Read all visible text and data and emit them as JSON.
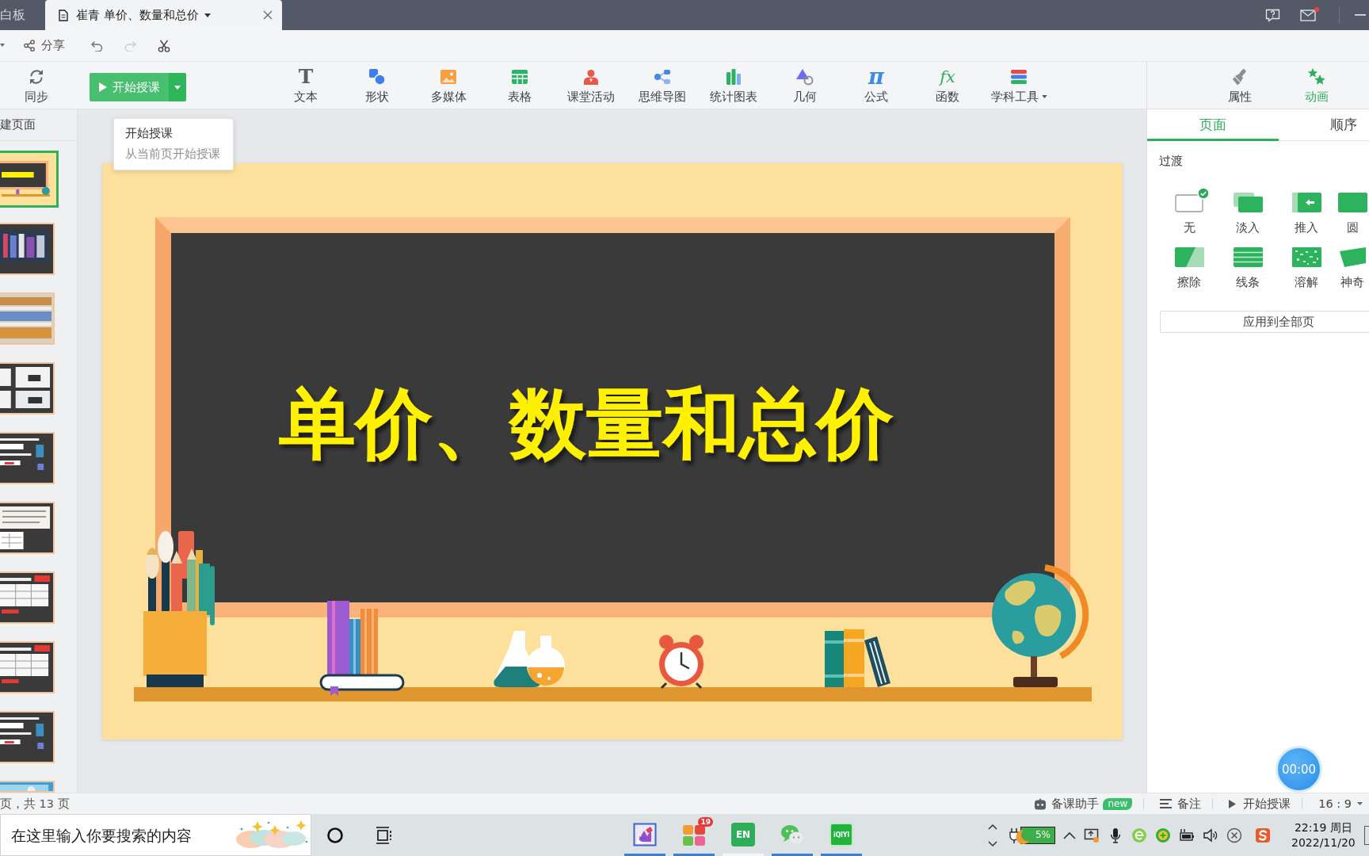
{
  "title_bar": {
    "tabs": [
      {
        "label": "白板",
        "selected": false
      },
      {
        "label": "崔青 单价、数量和总价",
        "selected": true
      }
    ],
    "mail_unread": true
  },
  "quick_bar": {
    "share": "分享",
    "undo_disabled": false,
    "redo_disabled": true
  },
  "ribbon": {
    "sync": "同步",
    "start_button": "开始授课",
    "tools": [
      {
        "kind": "text",
        "label": "文本",
        "glyph": "T"
      },
      {
        "kind": "shape",
        "label": "形状"
      },
      {
        "kind": "media",
        "label": "多媒体"
      },
      {
        "kind": "table",
        "label": "表格"
      },
      {
        "kind": "activity",
        "label": "课堂活动"
      },
      {
        "kind": "mindmap",
        "label": "思维导图"
      },
      {
        "kind": "chart",
        "label": "统计图表"
      },
      {
        "kind": "geometry",
        "label": "几何"
      },
      {
        "kind": "formula",
        "label": "公式",
        "glyph": "π"
      },
      {
        "kind": "function",
        "label": "函数",
        "glyph": "fx"
      },
      {
        "kind": "subject",
        "label": "学科工具",
        "menu": true
      }
    ],
    "panel_tabs": [
      {
        "kind": "properties",
        "label": "属性",
        "selected": false
      },
      {
        "kind": "animation",
        "label": "动画",
        "selected": true
      }
    ]
  },
  "tooltip": {
    "title": "开始授课",
    "description": "从当前页开始授课"
  },
  "page_list": {
    "header": "建页面",
    "thumbnails": [
      {
        "kind": "title",
        "selected": true
      },
      {
        "kind": "shop",
        "selected": false
      },
      {
        "kind": "shelves",
        "selected": false
      },
      {
        "kind": "prices",
        "selected": false
      },
      {
        "kind": "dialog",
        "selected": false
      },
      {
        "kind": "text",
        "selected": false
      },
      {
        "kind": "table",
        "selected": false
      },
      {
        "kind": "table",
        "selected": false
      },
      {
        "kind": "dialog",
        "selected": false
      },
      {
        "kind": "cover",
        "selected": false
      }
    ]
  },
  "slide": {
    "title": "单价、数量和总价"
  },
  "side_panel": {
    "tabs": [
      {
        "label": "页面",
        "selected": true
      },
      {
        "label": "顺序",
        "selected": false
      }
    ],
    "section": "过渡",
    "transitions": [
      {
        "kind": "none",
        "label": "无",
        "selected": true
      },
      {
        "kind": "fade",
        "label": "淡入",
        "selected": false
      },
      {
        "kind": "push",
        "label": "推入",
        "selected": false
      },
      {
        "kind": "circle",
        "label": "圆",
        "selected": false
      },
      {
        "kind": "wipe",
        "label": "擦除",
        "selected": false
      },
      {
        "kind": "lines",
        "label": "线条",
        "selected": false
      },
      {
        "kind": "dissolve",
        "label": "溶解",
        "selected": false
      },
      {
        "kind": "magic",
        "label": "神奇",
        "selected": false
      }
    ],
    "apply_button": "应用到全部页",
    "timer": "00:00"
  },
  "status_bar": {
    "page_info": "页，共 13 页",
    "assistant": "备课助手",
    "assistant_badge": "new",
    "notes": "备注",
    "start": "开始授课",
    "ratio": "16 : 9"
  },
  "taskbar": {
    "placeholder": "在这里输入你要搜索的内容",
    "apps": [
      {
        "kind": "paint",
        "running": true
      },
      {
        "kind": "store",
        "running": true,
        "badge": "19"
      },
      {
        "kind": "dictionary",
        "running": false,
        "label": "EN"
      },
      {
        "kind": "chat",
        "running": true
      },
      {
        "kind": "video",
        "running": true,
        "label": "iQIYI"
      }
    ],
    "battery": "5%",
    "time": "22:19 周日",
    "date": "2022/11/20"
  }
}
